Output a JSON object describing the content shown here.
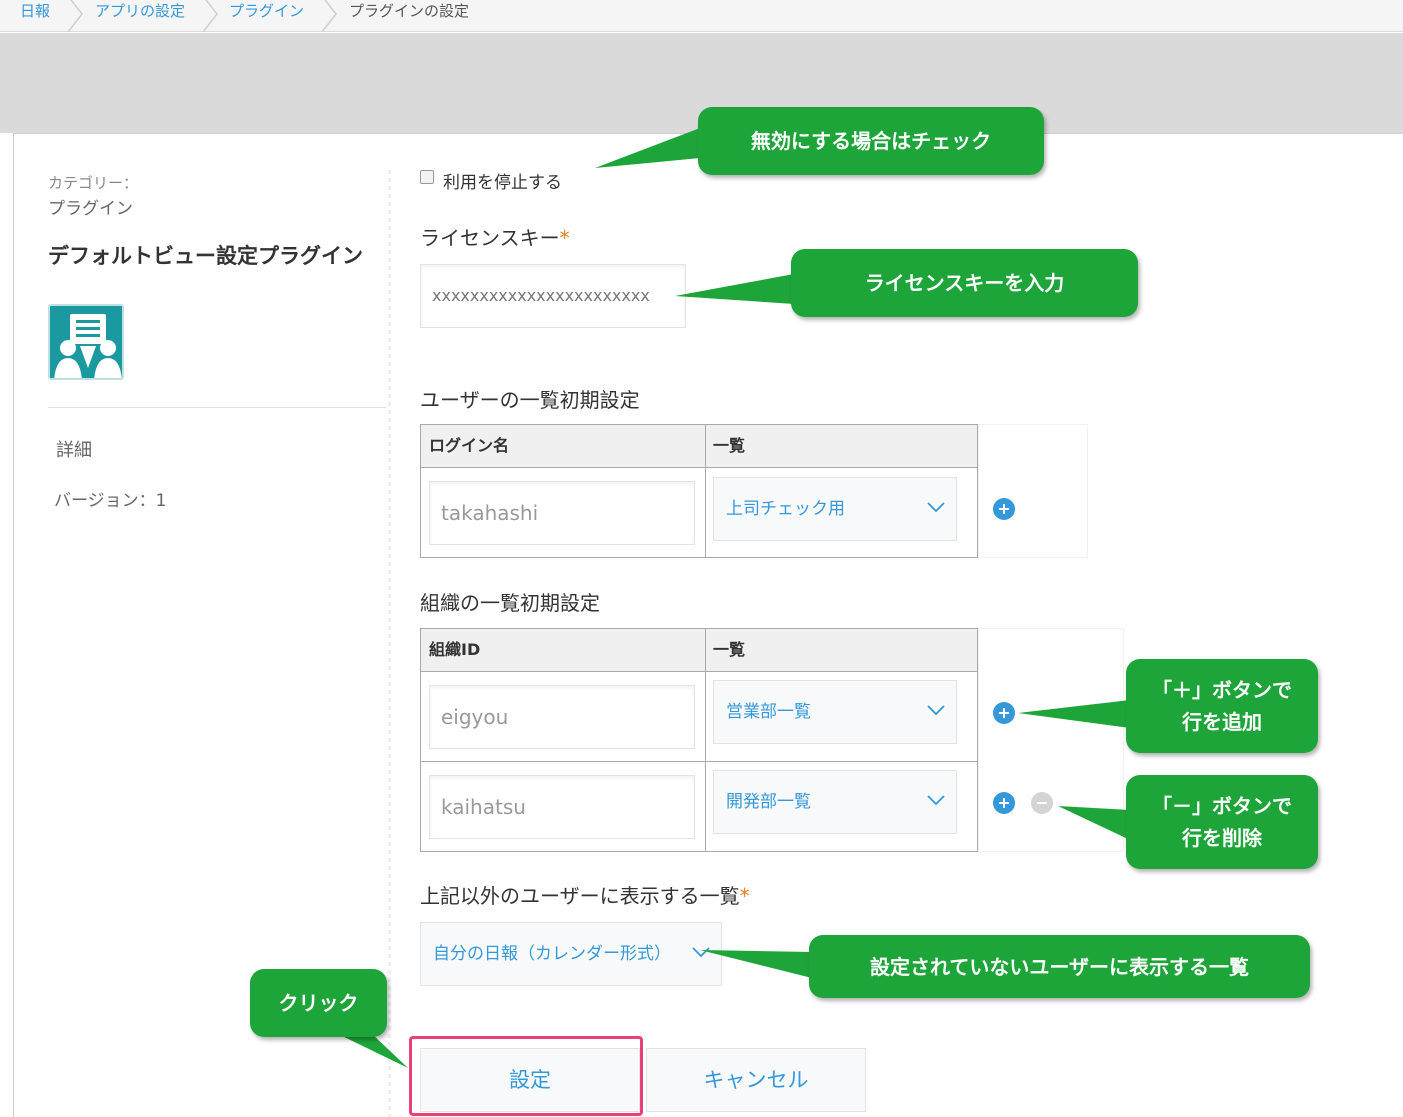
{
  "breadcrumb": [
    "日報",
    "アプリの設定",
    "プラグイン",
    "プラグインの設定"
  ],
  "sidebar": {
    "category_label": "カテゴリー：",
    "category_value": "プラグイン",
    "plugin_name": "デフォルトビュー設定プラグイン",
    "plugin_icon": "plugin-icon",
    "detail": "詳細",
    "version": "バージョン：1"
  },
  "form": {
    "disable_label": "利用を停止する",
    "disable_checked": false,
    "license_label": "ライセンスキー",
    "required_mark": "*",
    "license_value": "xxxxxxxxxxxxxxxxxxxxxxx",
    "user_section": {
      "title": "ユーザーの一覧初期設定",
      "headers": [
        "ログイン名",
        "一覧"
      ],
      "rows": [
        {
          "input": "takahashi",
          "select": "上司チェック用"
        }
      ]
    },
    "org_section": {
      "title": "組織の一覧初期設定",
      "headers": [
        "組織ID",
        "一覧"
      ],
      "rows": [
        {
          "input": "eigyou",
          "select": "営業部一覧"
        },
        {
          "input": "kaihatsu",
          "select": "開発部一覧"
        }
      ]
    },
    "other_label": "上記以外のユーザーに表示する一覧",
    "other_select": "自分の日報（カレンダー形式）",
    "save_button": "設定",
    "cancel_button": "キャンセル"
  },
  "callouts": {
    "disable": "無効にする場合はチェック",
    "license": "ライセンスキーを入力",
    "add": "「＋」ボタンで\n行を追加",
    "remove": "「－」ボタンで\n行を削除",
    "other": "設定されていないユーザーに表示する一覧",
    "click": "クリック"
  },
  "colors": {
    "accent": "#3498db",
    "callout": "#1ea53a",
    "highlight": "#e8417a",
    "required": "#e67e22"
  }
}
